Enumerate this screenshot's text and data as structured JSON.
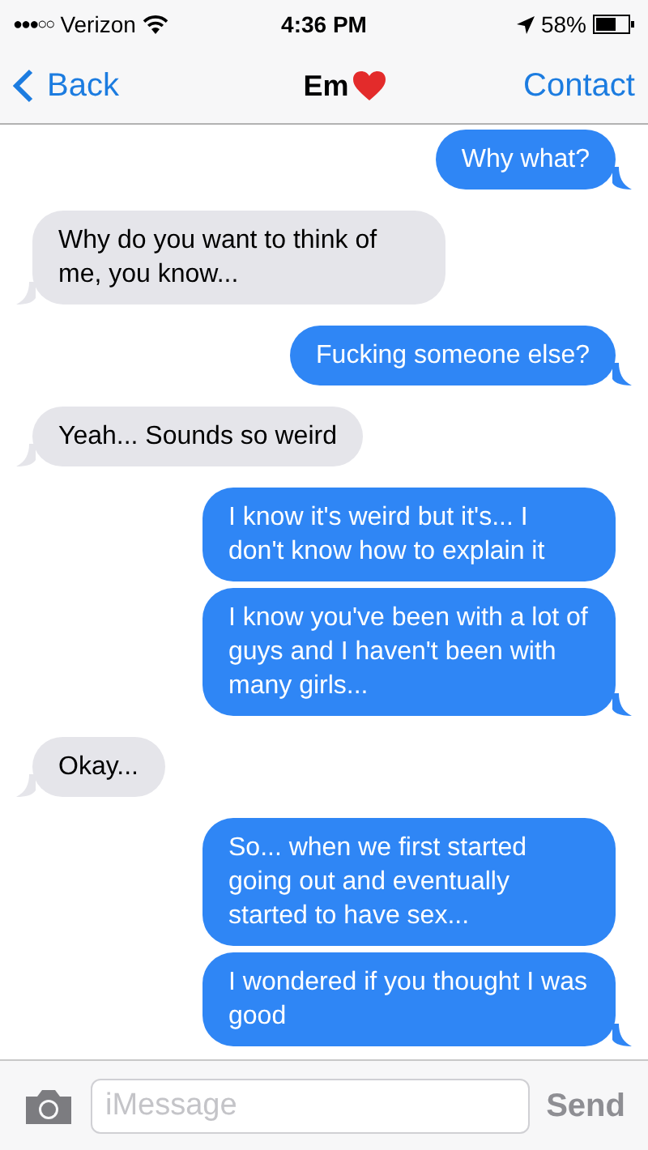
{
  "status_bar": {
    "signal": "●●●○○",
    "carrier": "Verizon",
    "time": "4:36 PM",
    "battery": "58%"
  },
  "nav": {
    "back": "Back",
    "title": "Em",
    "action": "Contact"
  },
  "messages": [
    {
      "kind": "sent",
      "text": "Why what?",
      "tail": true
    },
    {
      "kind": "received",
      "text": "Why do you want to think of me, you know...",
      "tail": true
    },
    {
      "kind": "sent",
      "text": "Fucking someone else?",
      "tail": true
    },
    {
      "kind": "received",
      "text": "Yeah... Sounds so weird",
      "tail": true
    },
    {
      "kind": "sent",
      "text": "I know it's weird but it's... I don't know how to explain it",
      "tail": false
    },
    {
      "kind": "sent",
      "text": "I know you've been with a lot of guys and I haven't been with many girls...",
      "tail": true
    },
    {
      "kind": "received",
      "text": "Okay...",
      "tail": true
    },
    {
      "kind": "sent",
      "text": "So... when we first started going out and eventually started to have sex...",
      "tail": false
    },
    {
      "kind": "sent",
      "text": "I wondered if you thought I was good",
      "tail": true
    }
  ],
  "composer": {
    "placeholder": "iMessage",
    "send": "Send"
  }
}
